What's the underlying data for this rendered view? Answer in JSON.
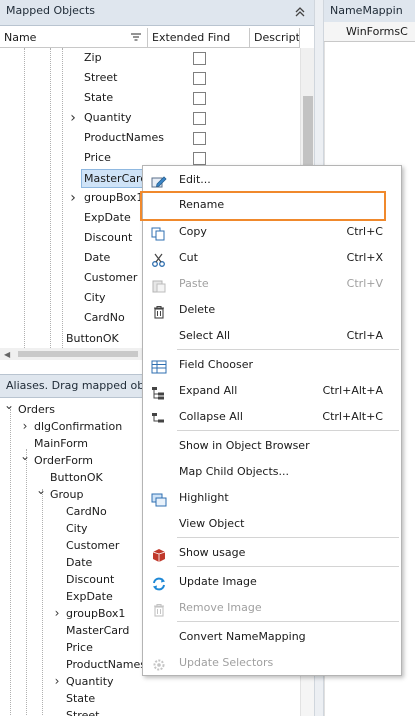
{
  "left_panel": {
    "title": "Mapped Objects",
    "columns": [
      "Name",
      "Extended Find",
      "Descriptio"
    ],
    "rows": [
      {
        "label": "Zip",
        "arrow": false
      },
      {
        "label": "Street",
        "arrow": false
      },
      {
        "label": "State",
        "arrow": false
      },
      {
        "label": "Quantity",
        "arrow": true
      },
      {
        "label": "ProductNames",
        "arrow": false
      },
      {
        "label": "Price",
        "arrow": false
      },
      {
        "label": "MasterCard",
        "arrow": false,
        "selected": true
      },
      {
        "label": "groupBox1",
        "arrow": true
      },
      {
        "label": "ExpDate",
        "arrow": false
      },
      {
        "label": "Discount",
        "arrow": false
      },
      {
        "label": "Date",
        "arrow": false
      },
      {
        "label": "Customer",
        "arrow": false
      },
      {
        "label": "City",
        "arrow": false
      },
      {
        "label": "CardNo",
        "arrow": false
      }
    ],
    "button_row": "ButtonOK"
  },
  "right_panel": {
    "title": "NameMappin",
    "column": "WinFormsC"
  },
  "aliases_panel": {
    "title": "Aliases. Drag mapped object",
    "tree": [
      {
        "label": "Orders",
        "level": 0,
        "arrow": "down"
      },
      {
        "label": "dlgConfirmation",
        "level": 1,
        "arrow": "right"
      },
      {
        "label": "MainForm",
        "level": 1,
        "arrow": ""
      },
      {
        "label": "OrderForm",
        "level": 1,
        "arrow": "down"
      },
      {
        "label": "ButtonOK",
        "level": 2,
        "arrow": ""
      },
      {
        "label": "Group",
        "level": 2,
        "arrow": "down"
      },
      {
        "label": "CardNo",
        "level": 3,
        "arrow": ""
      },
      {
        "label": "City",
        "level": 3,
        "arrow": ""
      },
      {
        "label": "Customer",
        "level": 3,
        "arrow": ""
      },
      {
        "label": "Date",
        "level": 3,
        "arrow": ""
      },
      {
        "label": "Discount",
        "level": 3,
        "arrow": ""
      },
      {
        "label": "ExpDate",
        "level": 3,
        "arrow": ""
      },
      {
        "label": "groupBox1",
        "level": 3,
        "arrow": "right"
      },
      {
        "label": "MasterCard",
        "level": 3,
        "arrow": ""
      },
      {
        "label": "Price",
        "level": 3,
        "arrow": ""
      },
      {
        "label": "ProductNames",
        "level": 3,
        "arrow": ""
      },
      {
        "label": "Quantity",
        "level": 3,
        "arrow": "right"
      },
      {
        "label": "State",
        "level": 3,
        "arrow": ""
      },
      {
        "label": "Street",
        "level": 3,
        "arrow": ""
      }
    ]
  },
  "context_menu": {
    "items": [
      {
        "id": "edit",
        "label": "Edit...",
        "shortcut": "",
        "icon": "edit-icon",
        "disabled": false
      },
      {
        "id": "rename",
        "label": "Rename",
        "shortcut": "",
        "icon": "",
        "disabled": false,
        "highlighted": true
      },
      {
        "id": "copy",
        "label": "Copy",
        "shortcut": "Ctrl+C",
        "icon": "copy-icon",
        "disabled": false
      },
      {
        "id": "cut",
        "label": "Cut",
        "shortcut": "Ctrl+X",
        "icon": "scissors-icon",
        "disabled": false
      },
      {
        "id": "paste",
        "label": "Paste",
        "shortcut": "Ctrl+V",
        "icon": "paste-icon",
        "disabled": true
      },
      {
        "id": "delete",
        "label": "Delete",
        "shortcut": "",
        "icon": "trash-icon",
        "disabled": false
      },
      {
        "id": "select-all",
        "label": "Select All",
        "shortcut": "Ctrl+A",
        "icon": "",
        "disabled": false
      },
      {
        "id": "field-chooser",
        "label": "Field Chooser",
        "shortcut": "",
        "icon": "field-chooser-icon",
        "disabled": false
      },
      {
        "id": "expand-all",
        "label": "Expand All",
        "shortcut": "Ctrl+Alt+A",
        "icon": "expand-icon",
        "disabled": false
      },
      {
        "id": "collapse-all",
        "label": "Collapse All",
        "shortcut": "Ctrl+Alt+C",
        "icon": "collapse-icon",
        "disabled": false
      },
      {
        "id": "show-in-object-browser",
        "label": "Show in Object Browser",
        "shortcut": "",
        "icon": "",
        "disabled": false
      },
      {
        "id": "map-child-objects",
        "label": "Map Child Objects...",
        "shortcut": "",
        "icon": "",
        "disabled": false
      },
      {
        "id": "highlight",
        "label": "Highlight",
        "shortcut": "",
        "icon": "highlight-icon",
        "disabled": false
      },
      {
        "id": "view-object",
        "label": "View Object",
        "shortcut": "",
        "icon": "",
        "disabled": false
      },
      {
        "id": "show-usage",
        "label": "Show usage",
        "shortcut": "",
        "icon": "usage-icon",
        "disabled": false
      },
      {
        "id": "update-image",
        "label": "Update Image",
        "shortcut": "",
        "icon": "refresh-icon",
        "disabled": false
      },
      {
        "id": "remove-image",
        "label": "Remove Image",
        "shortcut": "",
        "icon": "trash-icon",
        "disabled": true
      },
      {
        "id": "convert-namemapping",
        "label": "Convert NameMapping",
        "shortcut": "",
        "icon": "",
        "disabled": false
      },
      {
        "id": "update-selectors",
        "label": "Update Selectors",
        "shortcut": "",
        "icon": "gear-icon",
        "disabled": true
      }
    ]
  },
  "colors": {
    "header_bg": "#dfe6ee",
    "selection_bg": "#cfe3f7",
    "highlight_border": "#f0892c"
  }
}
